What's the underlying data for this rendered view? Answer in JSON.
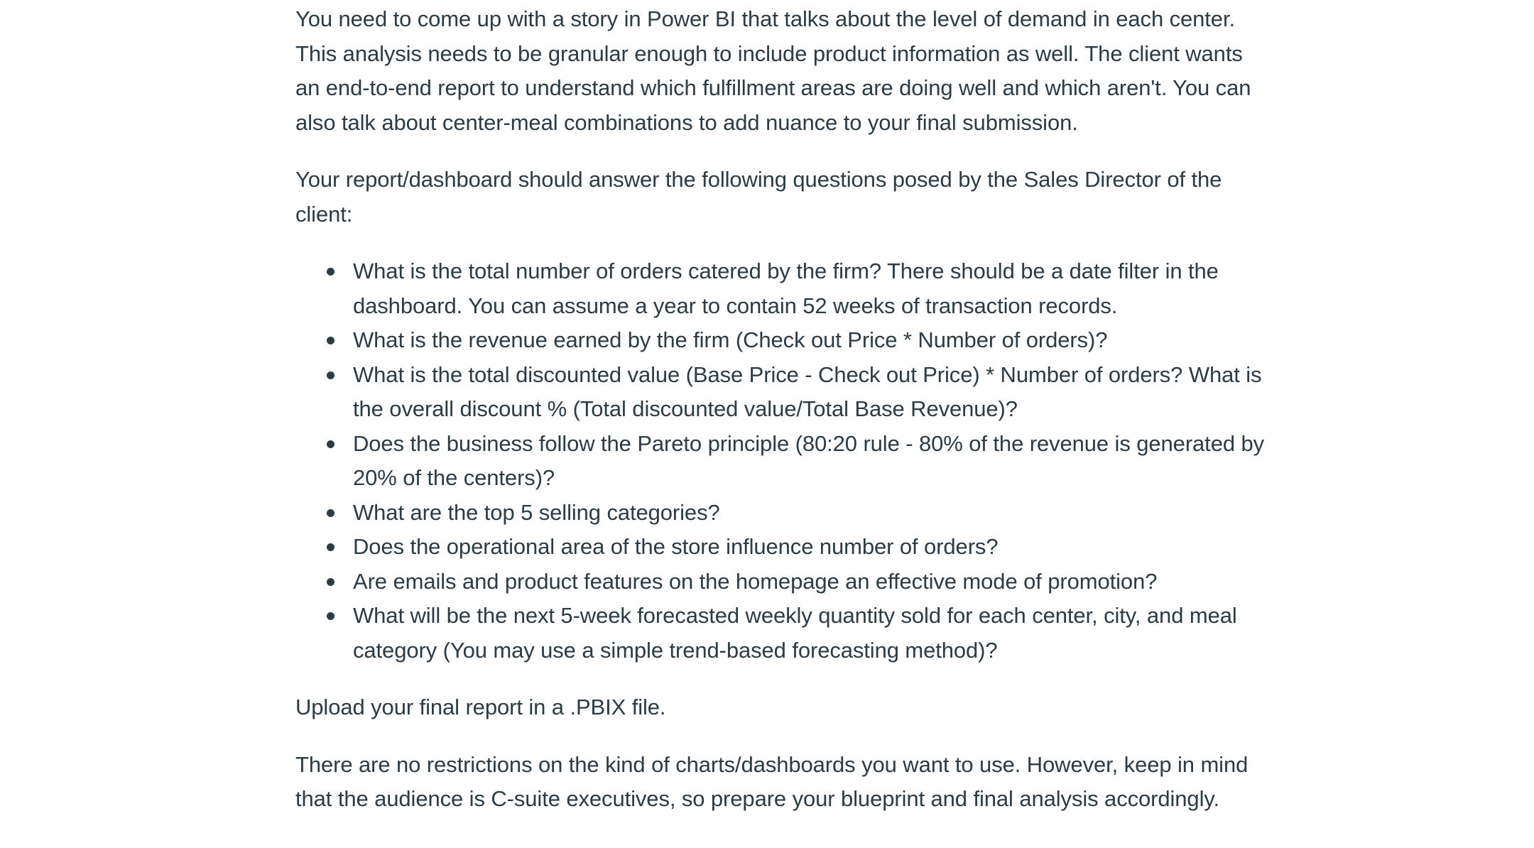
{
  "paragraphs": {
    "intro": "You need to come up with a story in Power BI that talks about the level of demand in each center. This analysis needs to be granular enough to include product information as well. The client wants an end-to-end report to understand which fulfillment areas are doing well and which aren't. You can also talk about center-meal combinations to add nuance to your final submission.",
    "questions_lead": "Your report/dashboard should answer the following questions posed by the Sales Director of the client:",
    "upload": "Upload your final report in a .PBIX file.",
    "closing": "There are no restrictions on the kind of charts/dashboards you want to use. However, keep in mind that the audience is C-suite executives, so prepare your blueprint and final analysis accordingly."
  },
  "questions": [
    "What is the total number of orders catered by the firm? There should be a date filter in the dashboard. You can assume a year to contain 52 weeks of transaction records.",
    "What is the revenue earned by the firm (Check out Price * Number of orders)?",
    "What is the total discounted value (Base Price - Check out Price) * Number of orders? What is the overall discount % (Total discounted value/Total Base Revenue)?",
    "Does the business follow the Pareto principle (80:20 rule - 80% of the revenue is generated by 20% of the centers)?",
    "What are the top 5 selling categories?",
    "Does the operational area of the store influence number of orders?",
    "Are emails and product features on the homepage an effective mode of promotion?",
    "What will be the next 5-week forecasted weekly quantity sold for each center, city, and meal category (You may use a simple trend-based forecasting method)?"
  ]
}
